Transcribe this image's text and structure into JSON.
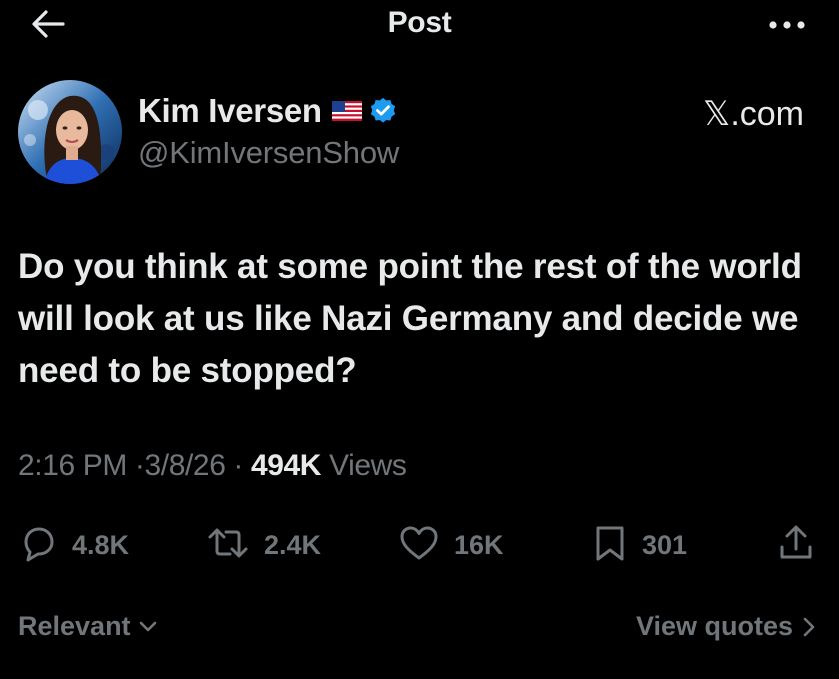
{
  "header": {
    "title": "Post",
    "back_icon": "arrow-left-icon",
    "more_icon": "more-horizontal-icon"
  },
  "author": {
    "display_name": "Kim Iversen",
    "flag_icon": "us-flag-icon",
    "verified_icon": "verified-badge-icon",
    "handle": "@KimIversenShow",
    "source": "𝕏.com"
  },
  "post": {
    "text": "Do you think at some point the rest of the world will look at us like Nazi Germany and decide we need to be stopped?",
    "time": "2:16 PM",
    "date": "3/8/26",
    "separator": "·",
    "views_count": "494K",
    "views_label": "Views"
  },
  "actions": {
    "replies": "4.8K",
    "reposts": "2.4K",
    "likes": "16K",
    "bookmarks": "301"
  },
  "footer": {
    "sort_label": "Relevant",
    "quotes_label": "View quotes"
  },
  "colors": {
    "background": "#000000",
    "primary_text": "#e7e9ea",
    "secondary_text": "#71767b",
    "verified_blue": "#1d9bf0"
  }
}
